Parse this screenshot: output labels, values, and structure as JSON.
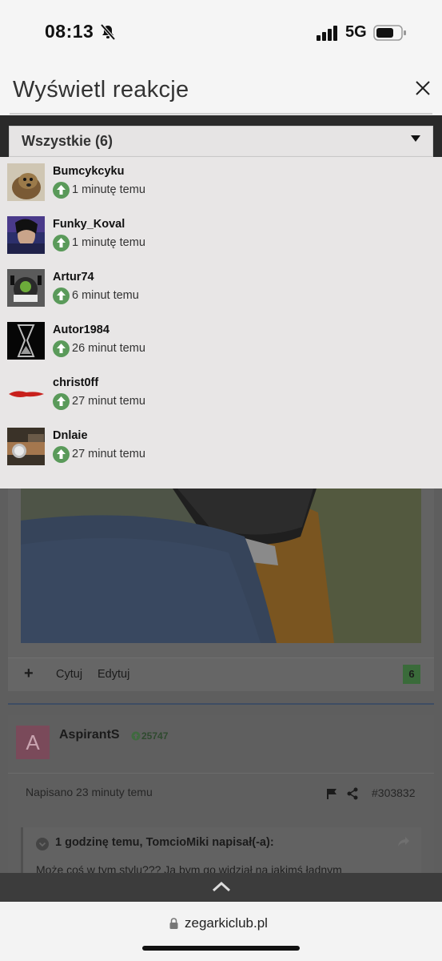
{
  "status_bar": {
    "time": "08:13",
    "network": "5G"
  },
  "modal": {
    "title": "Wyświetl reakcje",
    "filter": {
      "selected": "Wszystkie (6)"
    },
    "reactions": [
      {
        "user": "Bumcykcyku",
        "time": "1 minutę temu"
      },
      {
        "user": "Funky_Koval",
        "time": "1 minutę temu"
      },
      {
        "user": "Artur74",
        "time": "6 minut temu"
      },
      {
        "user": "Autor1984",
        "time": "26 minut temu"
      },
      {
        "user": "christ0ff",
        "time": "27 minut temu"
      },
      {
        "user": "Dnlaie",
        "time": "27 minut temu"
      }
    ]
  },
  "post": {
    "plus": "+",
    "quote": "Cytuj",
    "edit": "Edytuj",
    "reaction_count": "6"
  },
  "post2": {
    "avatar_letter": "A",
    "author": "AspirantS",
    "reputation": "25747",
    "date": "Napisano 23 minuty temu",
    "post_id": "#303832",
    "quote_header": "1 godzinę temu, TomcioMiki napisał(-a):",
    "quote_text": "Może coś w tym stylu??? Ja bym go widział na jakimś ładnym brązowym???"
  },
  "browser": {
    "url": "zegarkiclub.pl"
  },
  "colors": {
    "reaction_green": "#5a9a5a",
    "accent_blue": "#3e4d63"
  }
}
